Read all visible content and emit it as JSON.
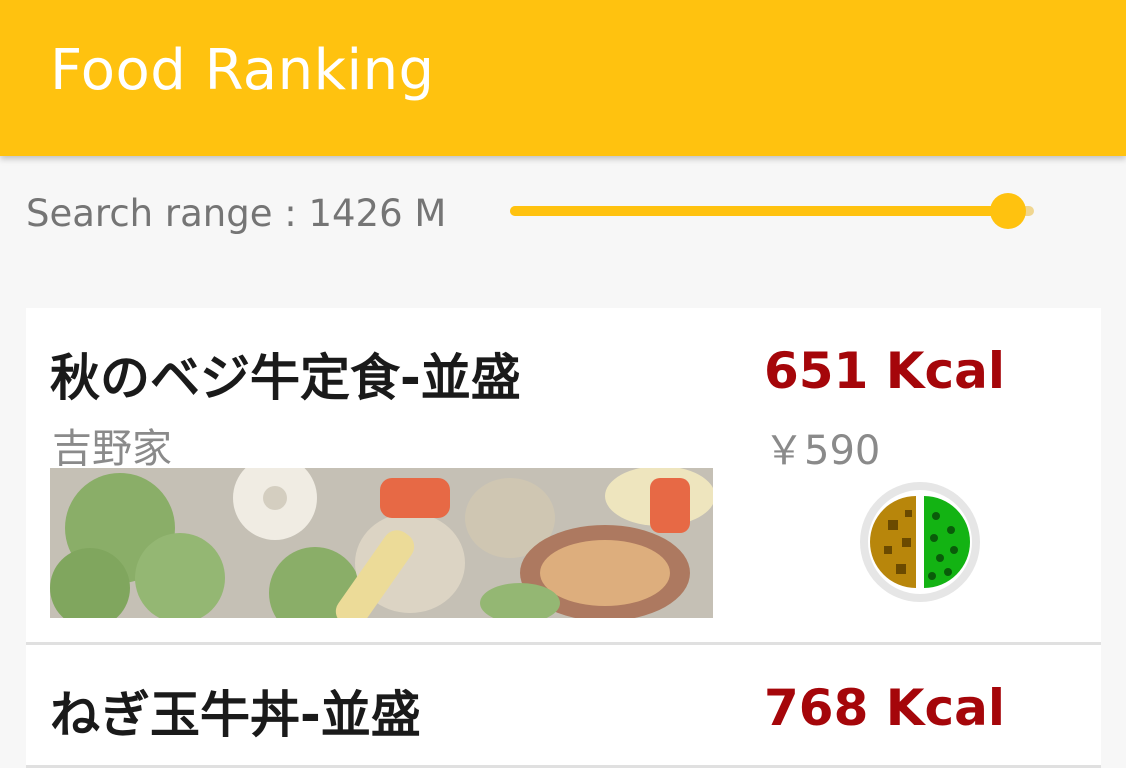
{
  "appbar": {
    "title": "Food Ranking"
  },
  "search_range": {
    "label": "Search range : 1426 M",
    "slider_fraction": 0.95
  },
  "colors": {
    "accent": "#ffc20f",
    "kcal": "#a5060a"
  },
  "items": [
    {
      "name": "秋のベジ牛定食-並盛",
      "shop": "吉野家",
      "kcal": "651 Kcal",
      "price": "￥590",
      "photo": "vegetable-beef-set-photo",
      "nutrition_icon": "meat-and-vegetable-balance-icon"
    },
    {
      "name": "ねぎ玉牛丼-並盛",
      "kcal": "768 Kcal"
    }
  ]
}
